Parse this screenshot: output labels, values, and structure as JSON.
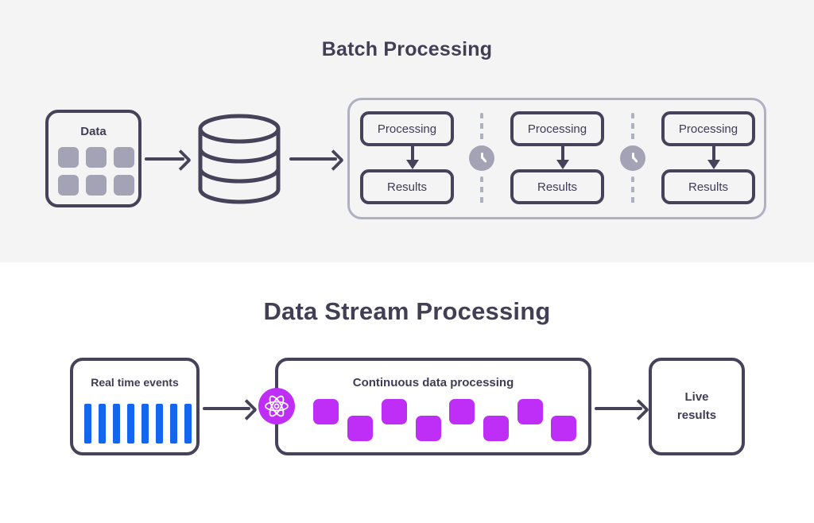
{
  "colors": {
    "background_top": "#f4f4f5",
    "background_bottom": "#ffffff",
    "outline_dark": "#454259",
    "text_dark": "#3f3d56",
    "muted_gray": "#a3a3b5",
    "panel_border": "#b0b0c3",
    "event_blue": "#1266f0",
    "chunk_purple": "#bf2ef7"
  },
  "batch": {
    "title": "Batch Processing",
    "data_box": {
      "label": "Data",
      "cells": [
        "cell-1",
        "cell-2",
        "cell-3",
        "cell-4",
        "cell-5",
        "cell-6"
      ]
    },
    "database_icon": "database-cylinder-icon",
    "arrows": [
      "arrow-data-to-database",
      "arrow-database-to-panel"
    ],
    "groups": [
      {
        "processing": "Processing",
        "results": "Results"
      },
      {
        "processing": "Processing",
        "results": "Results"
      },
      {
        "processing": "Processing",
        "results": "Results"
      }
    ],
    "separators": [
      {
        "icon": "clock-icon"
      },
      {
        "icon": "clock-icon"
      }
    ]
  },
  "stream": {
    "title": "Data Stream Processing",
    "events_box": {
      "label": "Real time events",
      "bars": [
        "bar-1",
        "bar-2",
        "bar-3",
        "bar-4",
        "bar-5",
        "bar-6",
        "bar-7",
        "bar-8"
      ]
    },
    "atom_icon": "atom-icon",
    "panel": {
      "label": "Continuous data processing",
      "chunks": [
        {
          "id": "chunk-1",
          "position": "hi"
        },
        {
          "id": "chunk-2",
          "position": "lo"
        },
        {
          "id": "chunk-3",
          "position": "hi"
        },
        {
          "id": "chunk-4",
          "position": "lo"
        },
        {
          "id": "chunk-5",
          "position": "hi"
        },
        {
          "id": "chunk-6",
          "position": "lo"
        },
        {
          "id": "chunk-7",
          "position": "hi"
        },
        {
          "id": "chunk-8",
          "position": "lo"
        }
      ]
    },
    "live_box": {
      "label": "Live\nresults"
    },
    "arrows": [
      "arrow-events-to-atom",
      "arrow-panel-to-live-results"
    ]
  }
}
